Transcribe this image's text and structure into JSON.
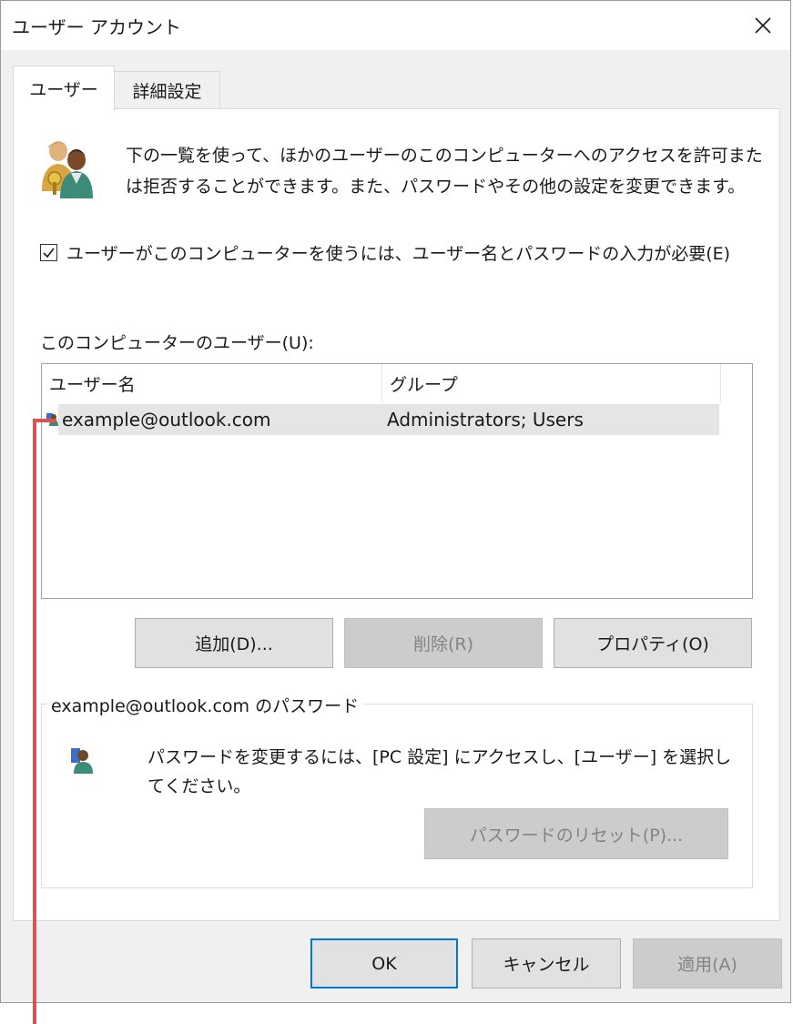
{
  "window": {
    "title": "ユーザー アカウント"
  },
  "tabs": [
    {
      "label": "ユーザー"
    },
    {
      "label": "詳細設定"
    }
  ],
  "intro_text": "下の一覧を使って、ほかのユーザーのこのコンピューターへのアクセスを許可または拒否することができます。また、パスワードやその他の設定を変更できます。",
  "login_checkbox": {
    "checked": true,
    "label": "ユーザーがこのコンピューターを使うには、ユーザー名とパスワードの入力が必要(E)"
  },
  "users_list": {
    "label": "このコンピューターのユーザー(U):",
    "columns": [
      "ユーザー名",
      "グループ"
    ],
    "rows": [
      {
        "username": "example@outlook.com",
        "group": "Administrators; Users",
        "selected": true
      }
    ]
  },
  "list_buttons": {
    "add": "追加(D)...",
    "remove": "削除(R)",
    "properties": "プロパティ(O)"
  },
  "password_group": {
    "title": "example@outlook.com のパスワード",
    "text": "パスワードを変更するには、[PC 設定] にアクセスし、[ユーザー] を選択してください。",
    "reset_button": "パスワードのリセット(P)..."
  },
  "footer": {
    "ok": "OK",
    "cancel": "キャンセル",
    "apply": "適用(A)"
  },
  "colors": {
    "accent": "#0078d7",
    "callout": "#d9534f",
    "selected_row": "#e5e5e5"
  }
}
